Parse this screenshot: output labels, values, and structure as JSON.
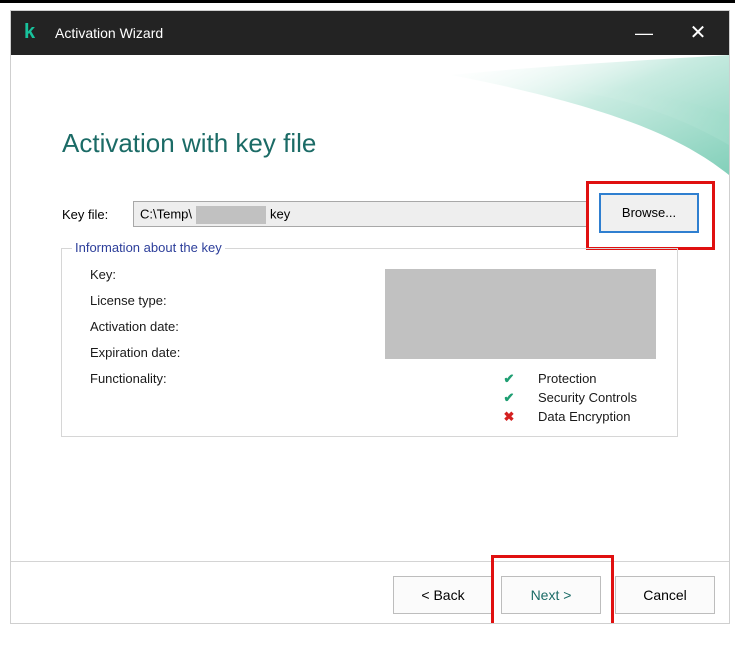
{
  "window": {
    "title": "Activation Wizard",
    "logo_char": "k",
    "minimize_glyph": "—",
    "close_glyph": "✕"
  },
  "page": {
    "heading": "Activation with key file"
  },
  "key_file": {
    "label": "Key file:",
    "value_prefix": "C:\\Temp\\",
    "value_suffix": "key",
    "browse_label": "Browse..."
  },
  "key_info": {
    "legend": "Information about the key",
    "labels": {
      "key": "Key:",
      "license_type": "License type:",
      "activation_date": "Activation date:",
      "expiration_date": "Expiration date:",
      "functionality": "Functionality:"
    },
    "features": [
      {
        "label": "Protection",
        "status": "enabled",
        "icon": "check-icon",
        "glyph": "✔"
      },
      {
        "label": "Security Controls",
        "status": "enabled",
        "icon": "check-icon",
        "glyph": "✔"
      },
      {
        "label": "Data Encryption",
        "status": "disabled",
        "icon": "cross-icon",
        "glyph": "✖"
      }
    ]
  },
  "footer": {
    "back_label": "< Back",
    "next_label": "Next >",
    "cancel_label": "Cancel"
  },
  "colors": {
    "accent": "#1b6b66",
    "highlight": "#e01010",
    "titlebar": "#232323"
  }
}
